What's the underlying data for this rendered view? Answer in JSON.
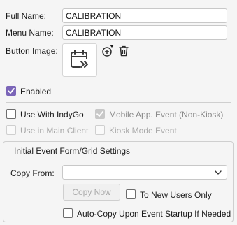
{
  "fields": {
    "full_name_label": "Full Name:",
    "full_name_value": "CALIBRATION",
    "menu_name_label": "Menu Name:",
    "menu_name_value": "CALIBRATION",
    "button_image_label": "Button Image:"
  },
  "checks": {
    "enabled": {
      "label": "Enabled",
      "checked": true
    },
    "use_with_indygo": {
      "label": "Use With IndyGo",
      "checked": false
    },
    "mobile_event": {
      "label": "Mobile App. Event (Non-Kiosk)",
      "checked": true
    },
    "use_in_main_client": {
      "label": "Use in Main Client",
      "checked": false
    },
    "kiosk_mode_event": {
      "label": "Kiosk Mode Event",
      "checked": false
    }
  },
  "group": {
    "title": "Initial Event Form/Grid Settings",
    "copy_from_label": "Copy From:",
    "copy_from_value": "",
    "copy_now_label": "Copy Now",
    "to_new_users_label": "To New Users Only",
    "auto_copy_label": "Auto-Copy Upon Event Startup If Needed"
  },
  "colors": {
    "accent": "#7b65b8",
    "disabled_text": "#a9a9a9"
  }
}
